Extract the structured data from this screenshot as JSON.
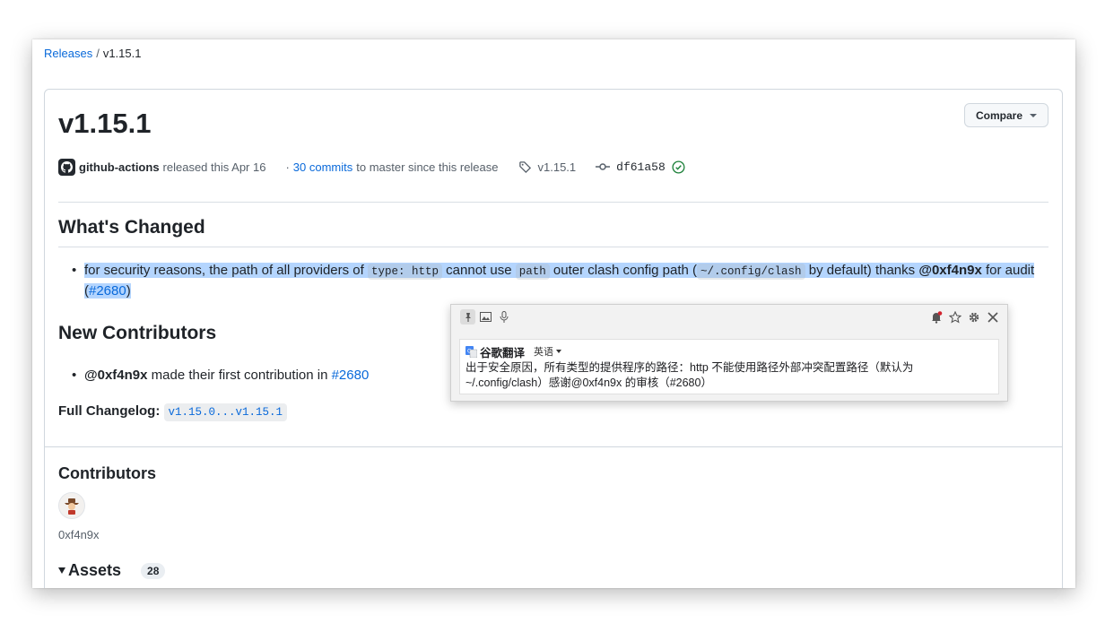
{
  "breadcrumb": {
    "releases": "Releases",
    "separator": "/",
    "current": "v1.15.1"
  },
  "release": {
    "title": "v1.15.1",
    "compare_label": "Compare",
    "author": "github-actions",
    "released_text": "released this Apr 16",
    "commits_prefix": "·",
    "commits_link": "30 commits",
    "commits_suffix": "to master since this release",
    "tag": "v1.15.1",
    "commit": "df61a58"
  },
  "whats_changed": {
    "heading": "What's Changed",
    "parts": [
      "for security reasons, the path of all providers of ",
      "type: http",
      " cannot use ",
      "path",
      " outer clash config path (",
      "~/.config/clash",
      " by default) thanks ",
      "@0xf4n9x",
      " for audit (",
      "#2680",
      ")"
    ]
  },
  "new_contributors": {
    "heading": "New Contributors",
    "user": "@0xf4n9x",
    "text": " made their first contribution in ",
    "link": "#2680"
  },
  "changelog": {
    "label": "Full Changelog:",
    "range": "v1.15.0...v1.15.1"
  },
  "contributors": {
    "heading": "Contributors",
    "name": "0xf4n9x"
  },
  "assets": {
    "heading": "Assets",
    "count": "28"
  },
  "translate_popup": {
    "service": "谷歌翻译",
    "language": "英语",
    "translation": "出于安全原因，所有类型的提供程序的路径：http 不能使用路径外部冲突配置路径（默认为 ~/.config/clash）感谢@0xf4n9x 的审核（#2680）"
  },
  "icons": [
    "github-logo-icon",
    "tag-icon",
    "commit-icon",
    "verified-check-icon",
    "pin-icon",
    "image-icon",
    "microphone-icon",
    "bell-icon",
    "star-icon",
    "gear-icon",
    "close-icon",
    "google-translate-icon"
  ],
  "colors": {
    "link": "#0969da",
    "highlight": "#b4d5fe",
    "verified": "#1a7f37",
    "bell": "#d1242f"
  }
}
